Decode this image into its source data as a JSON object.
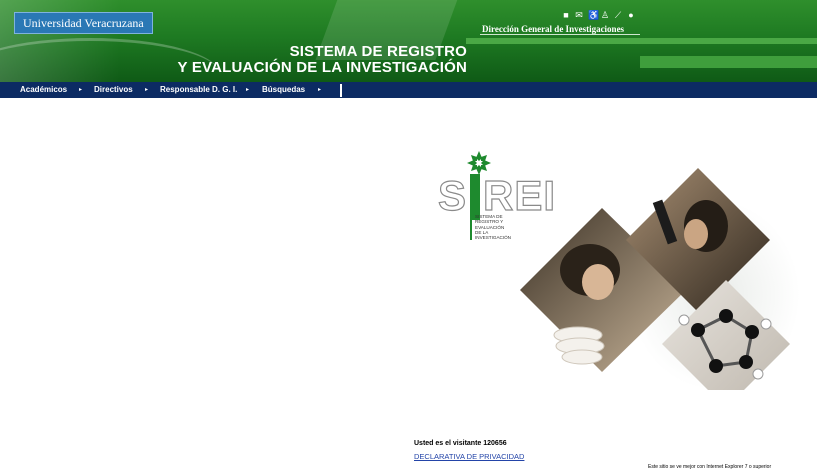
{
  "header": {
    "university": "Universidad Veracruzana",
    "title_line1": "SISTEMA DE REGISTRO",
    "title_line2": "Y EVALUACIÓN DE LA INVESTIGACIÓN",
    "department": "Dirección General de Investigaciones",
    "icons": [
      "home-icon",
      "mail-icon",
      "accessibility-icon",
      "sitemap-icon",
      "tools-icon",
      "globe-icon"
    ]
  },
  "nav": {
    "items": [
      {
        "label": "Académicos"
      },
      {
        "label": "Directivos"
      },
      {
        "label": "Responsable D. G. I."
      },
      {
        "label": "Búsquedas"
      }
    ]
  },
  "logo": {
    "word_left": "S",
    "word_right": "REI",
    "subtitle_lines": [
      "Sistema de",
      "Registro y",
      "Evaluación",
      "de la",
      "Investigación"
    ],
    "accent_color": "#1e8a2e"
  },
  "footer": {
    "visitor_text": "Usted es el visitante 120656",
    "privacy_link": "DECLARATIVA DE PRIVACIDAD",
    "browser_note": "Este sitio se ve mejor con Internet Explorer 7 o superior"
  },
  "colors": {
    "header_green": "#1e7a22",
    "nav_navy": "#0c2b63",
    "uv_blue": "#2a78b5",
    "link_blue": "#2344a8"
  }
}
